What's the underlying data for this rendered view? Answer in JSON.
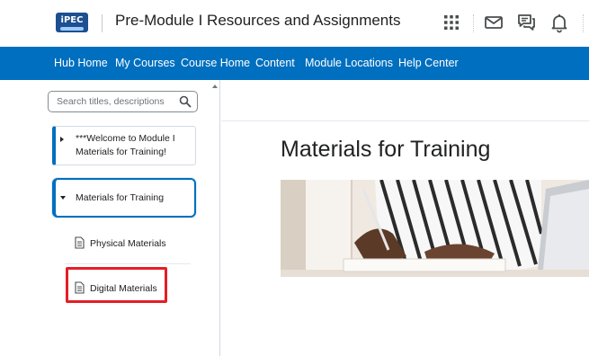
{
  "header": {
    "logo_text": "iPEC",
    "course_title": "Pre-Module I Resources and Assignments",
    "icons": [
      "apps-grid-icon",
      "mail-icon",
      "chat-icon",
      "bell-icon"
    ]
  },
  "nav": {
    "items": [
      {
        "label": "Hub Home"
      },
      {
        "label": "My Courses"
      },
      {
        "label": "Course Home"
      },
      {
        "label": "Content"
      },
      {
        "label": "Module Locations"
      },
      {
        "label": "Help Center"
      }
    ]
  },
  "sidebar": {
    "search_placeholder": "Search titles, descriptions",
    "modules": [
      {
        "label": "***Welcome to Module I Materials for Training!",
        "expanded": false
      },
      {
        "label": "Materials for Training",
        "expanded": true
      }
    ],
    "topics": [
      {
        "label": "Physical Materials",
        "icon": "document-icon"
      },
      {
        "label": "Digital Materials",
        "icon": "document-icon",
        "highlighted": true
      }
    ]
  },
  "main": {
    "title": "Materials for Training"
  },
  "colors": {
    "nav_bar": "#006fbf",
    "accent": "#006fbf",
    "highlight": "#e41e26",
    "logo": "#1d4f91"
  }
}
